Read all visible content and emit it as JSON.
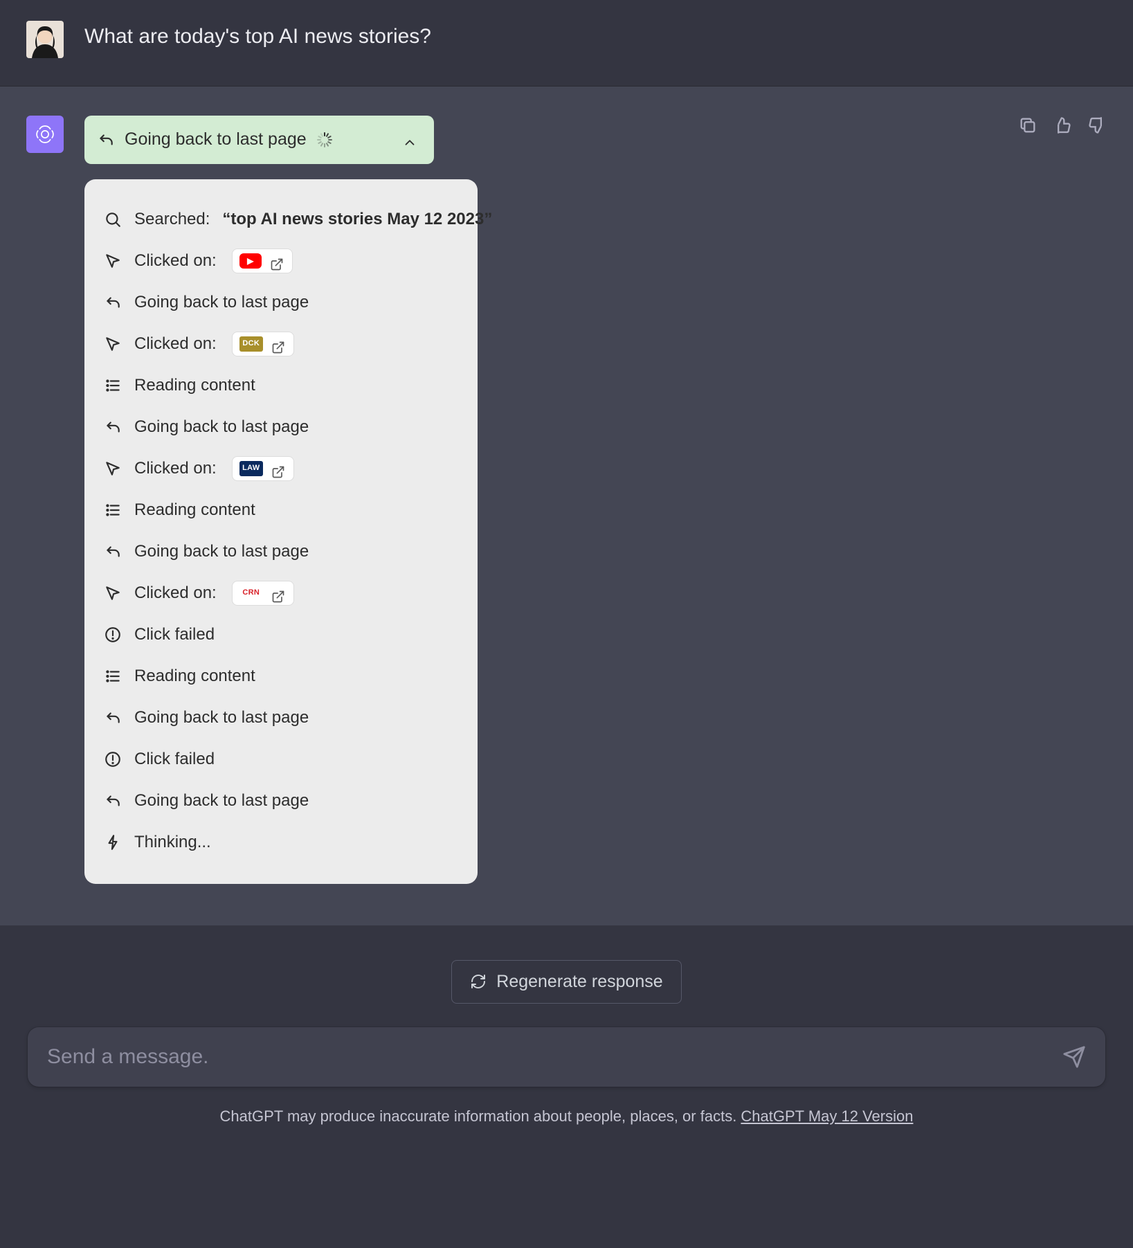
{
  "user": {
    "prompt": "What are today's top AI news stories?"
  },
  "status": {
    "text": "Going back to last page"
  },
  "steps": [
    {
      "type": "search",
      "label": "Searched:",
      "query": "“top AI news stories May 12 2023”"
    },
    {
      "type": "click",
      "label": "Clicked on:",
      "site": {
        "name": "youtube",
        "bg": "#ff0000",
        "text": "▶"
      }
    },
    {
      "type": "back",
      "label": "Going back to last page"
    },
    {
      "type": "click",
      "label": "Clicked on:",
      "site": {
        "name": "dck",
        "bg": "#a88f2b",
        "text": "DCK"
      }
    },
    {
      "type": "read",
      "label": "Reading content"
    },
    {
      "type": "back",
      "label": "Going back to last page"
    },
    {
      "type": "click",
      "label": "Clicked on:",
      "site": {
        "name": "law",
        "bg": "#0a2a5e",
        "text": "LAW"
      }
    },
    {
      "type": "read",
      "label": "Reading content"
    },
    {
      "type": "back",
      "label": "Going back to last page"
    },
    {
      "type": "click",
      "label": "Clicked on:",
      "site": {
        "name": "crn",
        "bg": "#ffffff",
        "fg": "#d9222a",
        "text": "CRN"
      }
    },
    {
      "type": "fail",
      "label": "Click failed"
    },
    {
      "type": "read",
      "label": "Reading content"
    },
    {
      "type": "back",
      "label": "Going back to last page"
    },
    {
      "type": "fail",
      "label": "Click failed"
    },
    {
      "type": "back",
      "label": "Going back to last page"
    },
    {
      "type": "think",
      "label": "Thinking..."
    }
  ],
  "composer": {
    "regenerate": "Regenerate response",
    "placeholder": "Send a message."
  },
  "footer": {
    "disclaimer": "ChatGPT may produce inaccurate information about people, places, or facts. ",
    "version_link": "ChatGPT May 12 Version"
  }
}
